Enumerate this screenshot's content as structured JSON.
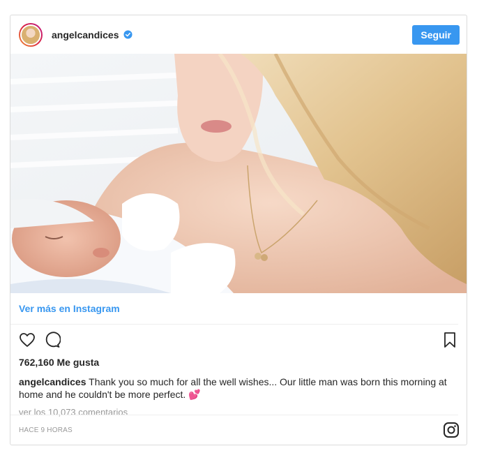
{
  "post": {
    "username": "angelcandices",
    "verified": true,
    "follow_label": "Seguir",
    "view_more_label": "Ver más en Instagram",
    "likes": "762,160 Me gusta",
    "caption_user": "angelcandices",
    "caption_text": "Thank you so much for all the well wishes... Our little man was born this morning at home and he couldn't be more perfect.",
    "caption_emoji": "💕",
    "comments_label": "ver los 10,073 comentarios",
    "timestamp": "Hace 9 horas"
  },
  "icons": {
    "verified": "verified-badge-icon",
    "like": "heart-icon",
    "comment": "comment-bubble-icon",
    "save": "bookmark-icon",
    "logo": "instagram-logo-icon"
  },
  "colors": {
    "accent": "#3897f0",
    "border": "#dbdbdb",
    "muted": "#999999",
    "text": "#262626"
  }
}
